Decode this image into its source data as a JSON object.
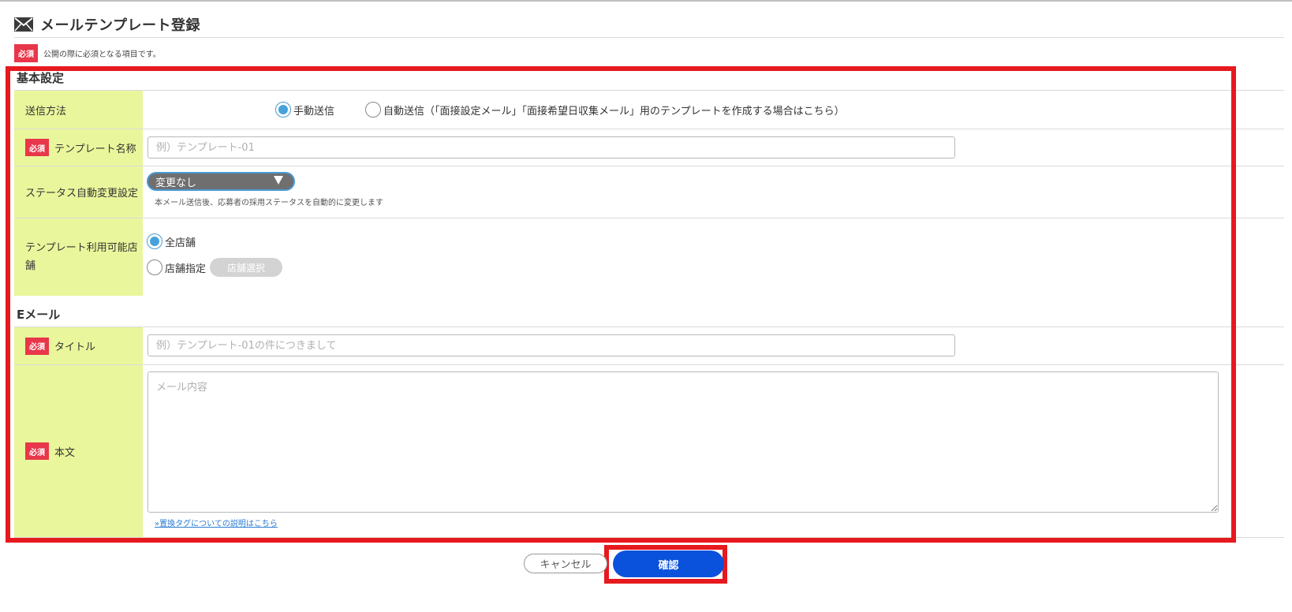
{
  "header": {
    "title": "メールテンプレート登録",
    "icon": "mail-icon"
  },
  "required_badge": "必須",
  "note": "公開の際に必須となる項目です。",
  "sections": {
    "basic": "基本設定",
    "email": "Eメール"
  },
  "send_method": {
    "label": "送信方法",
    "options": [
      {
        "label": "手動送信",
        "checked": true
      },
      {
        "label": "自動送信（「面接設定メール」「面接希望日収集メール」用のテンプレートを作成する場合はこちら）",
        "checked": false
      }
    ]
  },
  "template_name": {
    "label": "テンプレート名称",
    "placeholder": "例）テンプレート-01",
    "value": ""
  },
  "status_auto": {
    "label": "ステータス自動変更設定",
    "selected": "変更なし",
    "helper": "本メール送信後、応募者の採用ステータスを自動的に変更します"
  },
  "store_scope": {
    "label_line1": "テンプレート利用可能店",
    "label_line2": "舗",
    "options": [
      {
        "label": "全店舗",
        "checked": true
      },
      {
        "label": "店舗指定",
        "checked": false
      }
    ],
    "select_button": "店舗選択"
  },
  "email_title": {
    "label": "タイトル",
    "placeholder": "例）テンプレート-01の件につきまして",
    "value": ""
  },
  "email_body": {
    "label": "本文",
    "placeholder": "メール内容",
    "tag_link": "»置換タグについての説明はこちら"
  },
  "footer": {
    "cancel": "キャンセル",
    "confirm": "確認"
  },
  "colors": {
    "label_bg": "#eaf69b",
    "required_red": "#e8364a",
    "highlight_red": "#e6191e",
    "primary_blue": "#0a52db",
    "radio_blue": "#47a2db"
  }
}
